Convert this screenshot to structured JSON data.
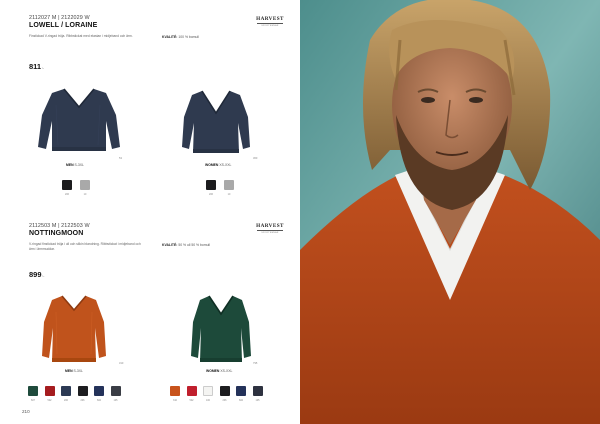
{
  "product1": {
    "art_no": "2112027 M | 2122029 W",
    "name": "LOWELL / LORAINE",
    "description": "Finstickad V-ringad tröja. Ribbstickat med elastan i midjeband och ärm.",
    "quality_label": "KVALITÉ:",
    "quality_value": "100 % bomull",
    "price": "811",
    "price_suffix": ":-",
    "men_label": "MEN",
    "men_sizes": "S-3XL",
    "women_label": "WOMEN",
    "women_sizes": "XS-XXL",
    "men_code": "53",
    "women_code": "360",
    "men_swatches": [
      {
        "color": "#1c1c1e",
        "code": "206"
      },
      {
        "color": "#a9a9a9",
        "code": "10"
      }
    ],
    "women_swatches": [
      {
        "color": "#1c1c1e",
        "code": "206"
      },
      {
        "color": "#a9a9a9",
        "code": "10"
      }
    ]
  },
  "product2": {
    "art_no": "2112503 M | 2122503 W",
    "name": "NOTTINGMOON",
    "description_line1": "V-ringad finstickad tröja i ull och silkin blandning. Ribbstickat i midjeband och",
    "description_line2": "ärm i ärmmuddar.",
    "quality_label": "KVALITÉ:",
    "quality_value": "50 % ull 50 % bomull",
    "price": "899",
    "price_suffix": ":-",
    "men_label": "MEN",
    "men_sizes": "S-3XL",
    "women_label": "WOMEN",
    "women_sizes": "XS-XXL",
    "men_code": "310",
    "women_code": "795",
    "men_swatches": [
      {
        "color": "#1f4b3c",
        "code": "607"
      },
      {
        "color": "#a51c1f",
        "code": "502"
      },
      {
        "color": "#2c3a54",
        "code": "200"
      },
      {
        "color": "#1d1d20",
        "code": "206"
      },
      {
        "color": "#24325a",
        "code": "602"
      },
      {
        "color": "#3a3d45",
        "code": "105"
      }
    ],
    "women_swatches": [
      {
        "color": "#c8531c",
        "code": "310"
      },
      {
        "color": "#c01f2d",
        "code": "502"
      },
      {
        "color": "#f4f4f2",
        "code": "100"
      },
      {
        "color": "#1d1d20",
        "code": "206"
      },
      {
        "color": "#24325a",
        "code": "602"
      },
      {
        "color": "#2e3240",
        "code": "105"
      }
    ]
  },
  "brand": {
    "name": "HARVEST",
    "tag": "SPORTSWEAR"
  },
  "page_number": "210"
}
